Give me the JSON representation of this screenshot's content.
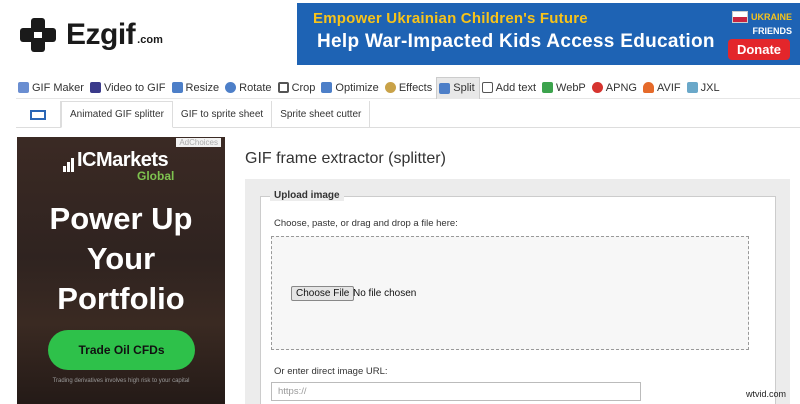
{
  "header": {
    "logo_text": "Ezgif",
    "logo_suffix": ".com"
  },
  "banner": {
    "line1": "Empower Ukrainian Children's Future",
    "line2": "Help War-Impacted Kids Access Education",
    "org_line1": "UKRAINE",
    "org_line2": "FRIENDS",
    "donate_label": "Donate",
    "colors": {
      "background": "#1e63b4",
      "headline": "#f7c31a",
      "donate": "#e3262b"
    }
  },
  "nav": {
    "items": [
      {
        "label": "GIF Maker",
        "icon": "image-icon",
        "color": "#6a8ed1"
      },
      {
        "label": "Video to GIF",
        "icon": "film-icon",
        "color": "#3a3a8a"
      },
      {
        "label": "Resize",
        "icon": "resize-icon",
        "color": "#4d7fc8"
      },
      {
        "label": "Rotate",
        "icon": "rotate-icon",
        "color": "#4d7fc8"
      },
      {
        "label": "Crop",
        "icon": "crop-icon",
        "color": "#555555"
      },
      {
        "label": "Optimize",
        "icon": "optimize-icon",
        "color": "#4d7fc8"
      },
      {
        "label": "Effects",
        "icon": "effects-icon",
        "color": "#c9a248"
      },
      {
        "label": "Split",
        "icon": "split-icon",
        "color": "#4d7fc8",
        "active": true
      },
      {
        "label": "Add text",
        "icon": "text-icon",
        "color": "#555555"
      },
      {
        "label": "WebP",
        "icon": "webp-icon",
        "color": "#3ca34d"
      },
      {
        "label": "APNG",
        "icon": "apng-icon",
        "color": "#d6342f"
      },
      {
        "label": "AVIF",
        "icon": "avif-icon",
        "color": "#e56a2a"
      },
      {
        "label": "JXL",
        "icon": "jxl-icon",
        "color": "#6aa8c9"
      }
    ]
  },
  "subnav": {
    "tabs": [
      {
        "label": "Animated GIF splitter",
        "active": true
      },
      {
        "label": "GIF to sprite sheet"
      },
      {
        "label": "Sprite sheet cutter"
      }
    ]
  },
  "ad": {
    "choices_label": "AdChoices",
    "brand": "ICMarkets",
    "brand_sub": "Global",
    "headline": [
      "Power Up",
      "Your",
      "Portfolio"
    ],
    "cta": "Trade Oil CFDs",
    "disclaimer": "Trading derivatives involves high risk to your capital",
    "colors": {
      "accent": "#2ec14a",
      "sub": "#7ec34f"
    }
  },
  "main": {
    "title": "GIF frame extractor (splitter)",
    "upload": {
      "legend": "Upload image",
      "choose_label": "Choose, paste, or drag and drop a file here:",
      "file_button": "Choose File",
      "file_status": "No file chosen",
      "url_label": "Or enter direct image URL:",
      "url_placeholder": "https://"
    }
  },
  "watermark": "wtvid.com"
}
